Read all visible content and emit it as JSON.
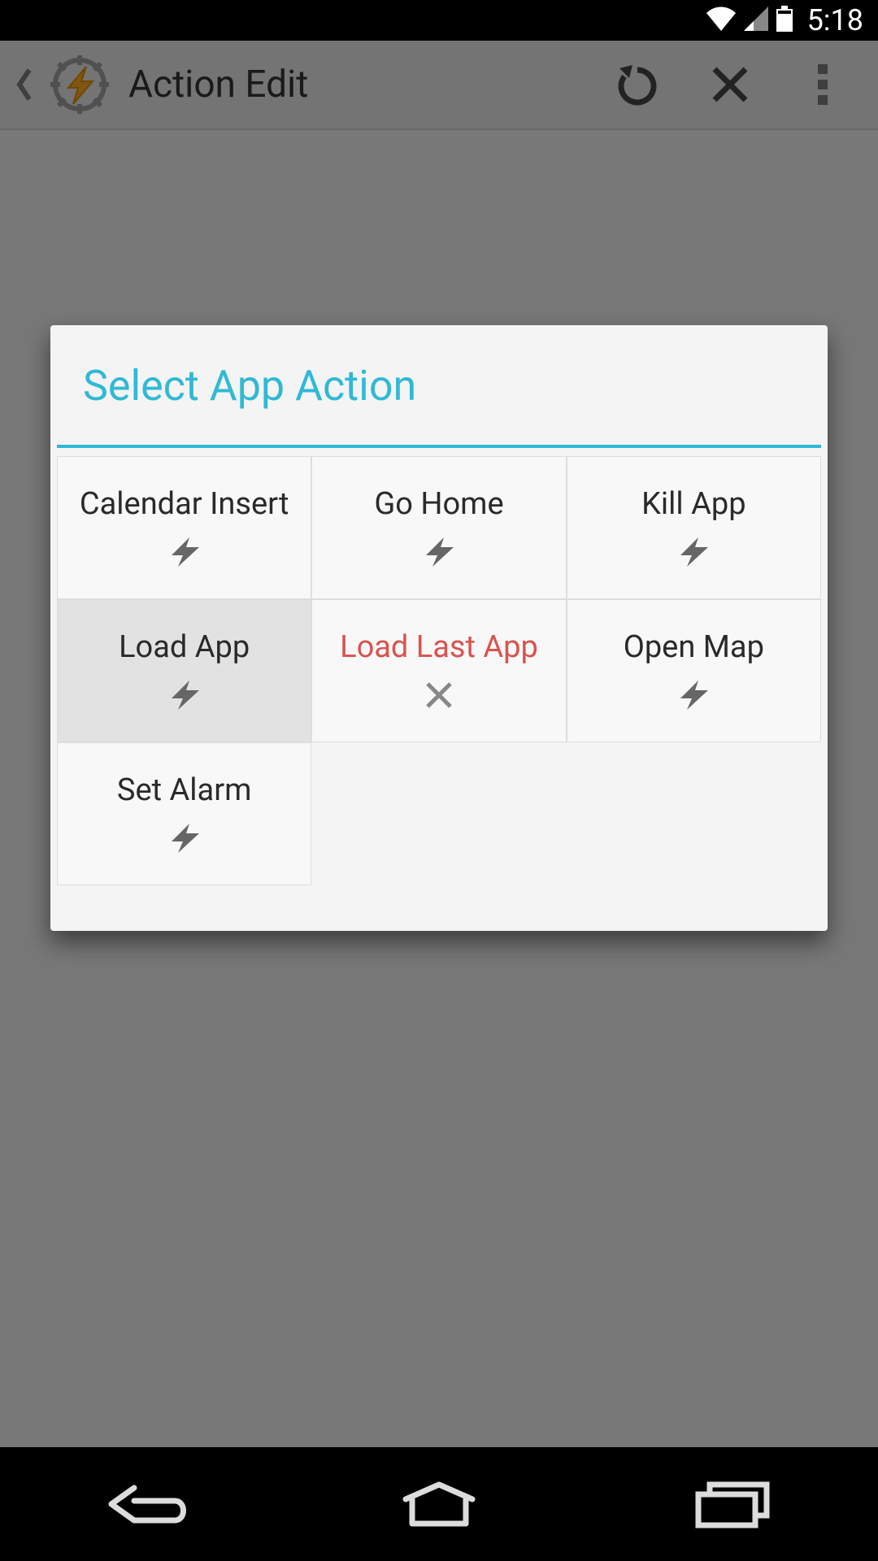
{
  "status_bar": {
    "time": "5:18"
  },
  "app_bar": {
    "title": "Action Edit"
  },
  "dialog": {
    "title": "Select App Action",
    "tiles": [
      {
        "label": "Calendar Insert",
        "icon": "bolt",
        "warn": false,
        "selected": false
      },
      {
        "label": "Go Home",
        "icon": "bolt",
        "warn": false,
        "selected": false
      },
      {
        "label": "Kill App",
        "icon": "bolt",
        "warn": false,
        "selected": false
      },
      {
        "label": "Load App",
        "icon": "bolt",
        "warn": false,
        "selected": true
      },
      {
        "label": "Load Last App",
        "icon": "x",
        "warn": true,
        "selected": false
      },
      {
        "label": "Open Map",
        "icon": "bolt",
        "warn": false,
        "selected": false
      },
      {
        "label": "Set Alarm",
        "icon": "bolt",
        "warn": false,
        "selected": false
      }
    ]
  }
}
